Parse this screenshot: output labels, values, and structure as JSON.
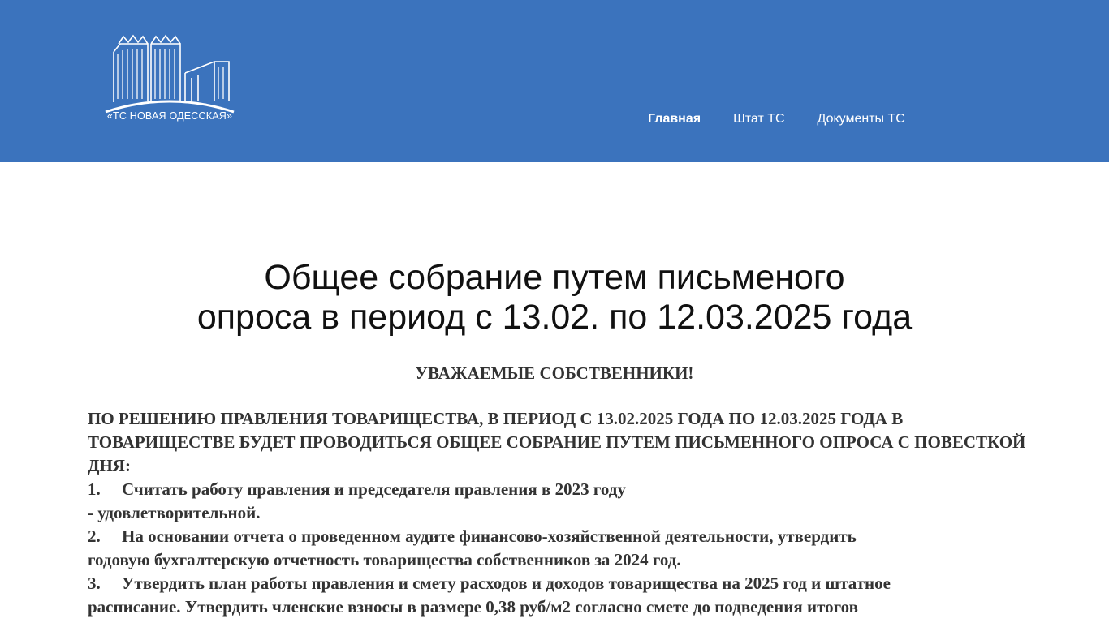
{
  "header": {
    "logo_text": "«ТС НОВАЯ ОДЕССКАЯ»",
    "background_color": "#3b73bd",
    "nav": [
      {
        "label": "Главная",
        "active": true
      },
      {
        "label": "Штат ТС",
        "active": false
      },
      {
        "label": "Документы ТС",
        "active": false
      }
    ]
  },
  "main": {
    "title_line1": "Общее собрание путем письменого",
    "title_line2": "опроса в период с 13.02. по 12.03.2025 года",
    "greeting": "УВАЖАЕМЫЕ СОБСТВЕННИКИ!",
    "intro": "ПО РЕШЕНИЮ ПРАВЛЕНИЯ ТОВАРИЩЕСТВА, В ПЕРИОД С 13.02.2025 ГОДА ПО 12.03.2025 ГОДА В ТОВАРИЩЕСТВЕ БУДЕТ ПРОВОДИТЬСЯ ОБЩЕЕ СОБРАНИЕ ПУТЕМ ПИСЬМЕННОГО ОПРОСА С ПОВЕСТКОЙ ДНЯ:",
    "items": [
      {
        "num": "1.",
        "line1": "Считать работу правления и председателя правления в 2023 году",
        "line2": "- удовлетворительной."
      },
      {
        "num": "2.",
        "line1": "На основании отчета о проведенном аудите финансово-хозяйственной деятельности, утвердить",
        "line2": "годовую бухгалтерскую отчетность товарищества собственников за 2024 год."
      },
      {
        "num": "3.",
        "line1": "Утвердить план работы правления и смету расходов и доходов товарищества на 2025 год и штатное",
        "line2": "расписание. Утвердить членские взносы в размере 0,38 руб/м2 согласно смете до подведения итогов"
      }
    ]
  }
}
